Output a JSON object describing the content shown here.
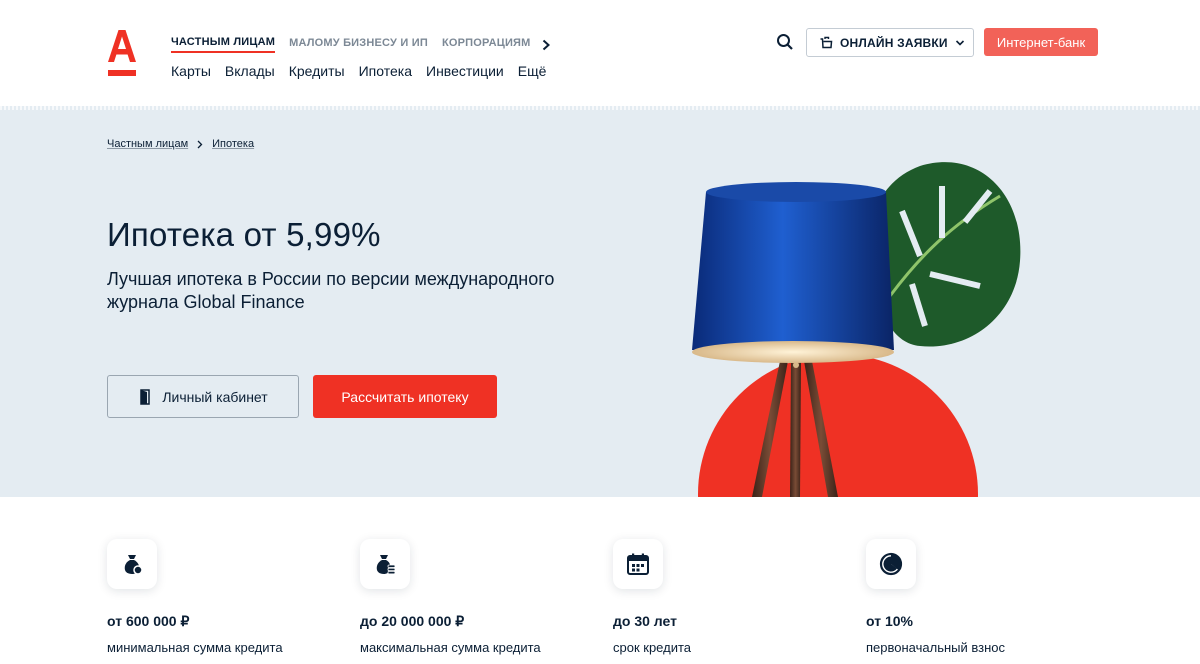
{
  "header": {
    "segments": [
      {
        "label": "ЧАСТНЫМ ЛИЦАМ",
        "active": true
      },
      {
        "label": "МАЛОМУ БИЗНЕСУ И ИП",
        "active": false
      },
      {
        "label": "КОРПОРАЦИЯМ",
        "active": false
      }
    ],
    "nav": [
      "Карты",
      "Вклады",
      "Кредиты",
      "Ипотека",
      "Инвестиции",
      "Ещё"
    ],
    "orders_label": "ОНЛАЙН ЗАЯВКИ",
    "bank_label": "Интернет-банк",
    "icons": {
      "search": "search-icon",
      "cart": "cart-icon",
      "chevron": "chevron-down-icon",
      "segments_next": "chevron-right-icon"
    }
  },
  "breadcrumb": [
    "Частным лицам",
    "Ипотека"
  ],
  "hero": {
    "title": "Ипотека от 5,99%",
    "subtitle": "Лучшая ипотека в России по версии международного журнала Global Finance",
    "cabinet_label": "Личный кабинет",
    "calc_label": "Рассчитать ипотеку"
  },
  "features": [
    {
      "value": "от 600 000 ₽",
      "label": "минимальная сумма кредита",
      "icon": "money-bag-icon"
    },
    {
      "value": "до 20 000 000 ₽",
      "label": "максимальная сумма кредита",
      "icon": "money-bag-coins-icon"
    },
    {
      "value": "до 30 лет",
      "label": "срок кредита",
      "icon": "calendar-icon"
    },
    {
      "value": "от 10%",
      "label": "первоначальный взнос",
      "icon": "pie-chart-icon"
    }
  ],
  "colors": {
    "brand_red": "#ef3124",
    "bank_button": "#f26258",
    "hero_background": "#e4ecf2",
    "text_dark": "#0b1f35"
  }
}
